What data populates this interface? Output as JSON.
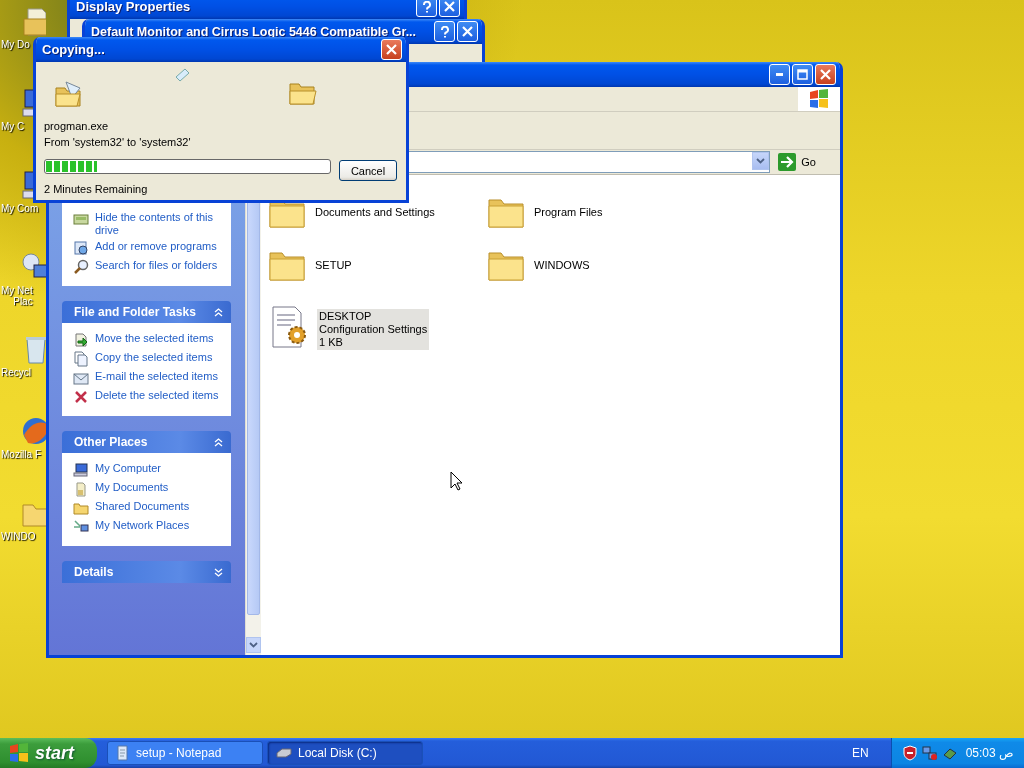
{
  "desktop_icons": [
    {
      "label_lines": [
        "My Do"
      ]
    },
    {
      "label_lines": [
        "My C"
      ]
    },
    {
      "label_lines": [
        "My Com"
      ]
    },
    {
      "label_lines": [
        "My Net",
        "Plac"
      ]
    },
    {
      "label_lines": [
        "Recycl"
      ]
    },
    {
      "label_lines": [
        "Mozilla F"
      ]
    },
    {
      "label_lines": [
        "WINDO"
      ]
    }
  ],
  "background_windows": [
    {
      "title": "Display Properties"
    },
    {
      "title": "Default Monitor and Cirrus Logic 5446 Compatible Gr..."
    }
  ],
  "explorer": {
    "go_label": "Go",
    "task_panes": [
      {
        "items": [
          "Hide the contents of this drive",
          "Add or remove programs",
          "Search for files or folders"
        ]
      },
      {
        "title": "File and Folder Tasks",
        "expanded": true,
        "items": [
          "Move the selected items",
          "Copy the selected items",
          "E-mail the selected items",
          "Delete the selected items"
        ]
      },
      {
        "title": "Other Places",
        "expanded": true,
        "items": [
          "My Computer",
          "My Documents",
          "Shared Documents",
          "My Network Places"
        ]
      },
      {
        "title": "Details",
        "expanded": false
      }
    ],
    "files": [
      {
        "kind": "folder",
        "name": "Documents and Settings",
        "selected": false
      },
      {
        "kind": "folder",
        "name": "Program Files",
        "selected": false
      },
      {
        "kind": "folder",
        "name": "SETUP",
        "selected": false
      },
      {
        "kind": "folder",
        "name": "WINDOWS",
        "selected": false
      },
      {
        "kind": "file",
        "name": "DESKTOP",
        "details": [
          "Configuration Settings",
          "1 KB"
        ],
        "selected": true
      }
    ]
  },
  "copy_dialog": {
    "title": "Copying...",
    "file": "progman.exe",
    "from_to": "From 'system32' to 'system32'",
    "level": 0.18,
    "remaining": "2 Minutes Remaining",
    "cancel": "Cancel"
  },
  "taskbar": {
    "start": "start",
    "tasks": [
      {
        "label": "setup - Notepad",
        "selected": false
      },
      {
        "label": "Local Disk (C:)",
        "selected": true
      }
    ],
    "language": "EN",
    "time": "05:03 ص"
  }
}
